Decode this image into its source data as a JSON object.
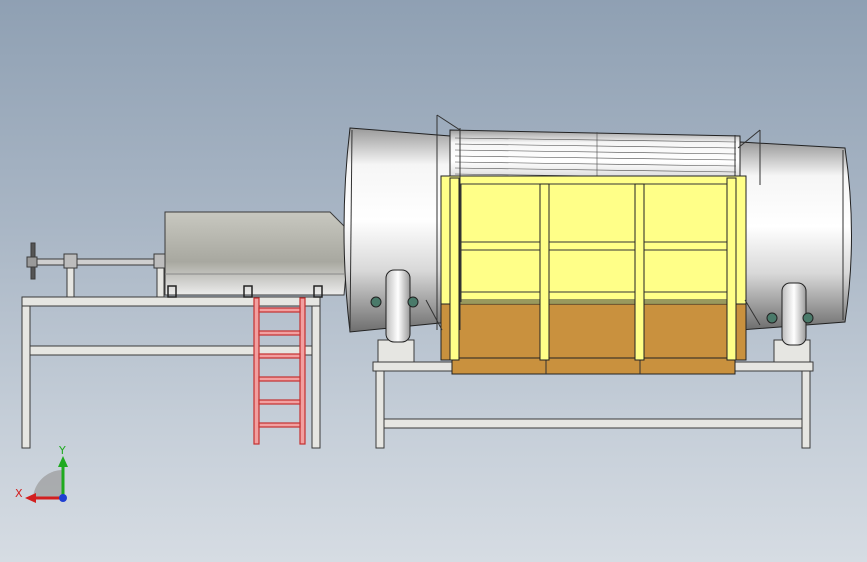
{
  "viewport": {
    "background_top": "#8fa0b3",
    "background_bottom": "#d6dce3"
  },
  "colors": {
    "frame_fill": "#e6e6e2",
    "frame_stroke": "#3a3a3a",
    "drum_light": "#f4f4f4",
    "drum_dark": "#7d7d7d",
    "hopper": "#b0b0a8",
    "ladder": "#e05050",
    "housing_yellow": "#ffff88",
    "housing_gold": "#c9913e",
    "axis_x": "#d21f1f",
    "axis_y": "#1faa1f",
    "axis_z": "#1f3fd2"
  },
  "triad": {
    "x_label": "X",
    "y_label": "Y"
  }
}
